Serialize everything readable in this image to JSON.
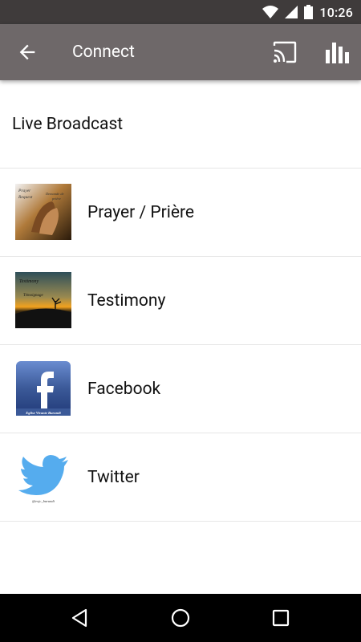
{
  "status": {
    "time": "10:26"
  },
  "app_bar": {
    "title": "Connect"
  },
  "section": {
    "title": "Live Broadcast"
  },
  "items": [
    {
      "label": "Prayer / Prière",
      "thumb": {
        "top_left": "Prayer",
        "top_left2": "Request",
        "top_right": "Demande de",
        "top_right2": "prière"
      }
    },
    {
      "label": "Testimony",
      "thumb": {
        "line1": "Testimony",
        "line2": "Témoignage"
      }
    },
    {
      "label": "Facebook",
      "thumb": {
        "caption": "Eglise Vivante Burundi"
      }
    },
    {
      "label": "Twitter",
      "thumb": {
        "caption": "@evjc_burundi"
      }
    }
  ],
  "icons": {
    "status": [
      "wifi-icon",
      "signal-icon",
      "battery-icon"
    ],
    "app_bar": [
      "back-arrow-icon",
      "cast-icon",
      "bar-chart-icon"
    ],
    "nav": [
      "back-triangle-icon",
      "home-circle-icon",
      "recents-square-icon"
    ]
  },
  "colors": {
    "status_bar": "#3f3b3b",
    "app_bar": "#6e6869",
    "twitter_blue": "#55acee",
    "facebook_blue": "#3b5998"
  }
}
